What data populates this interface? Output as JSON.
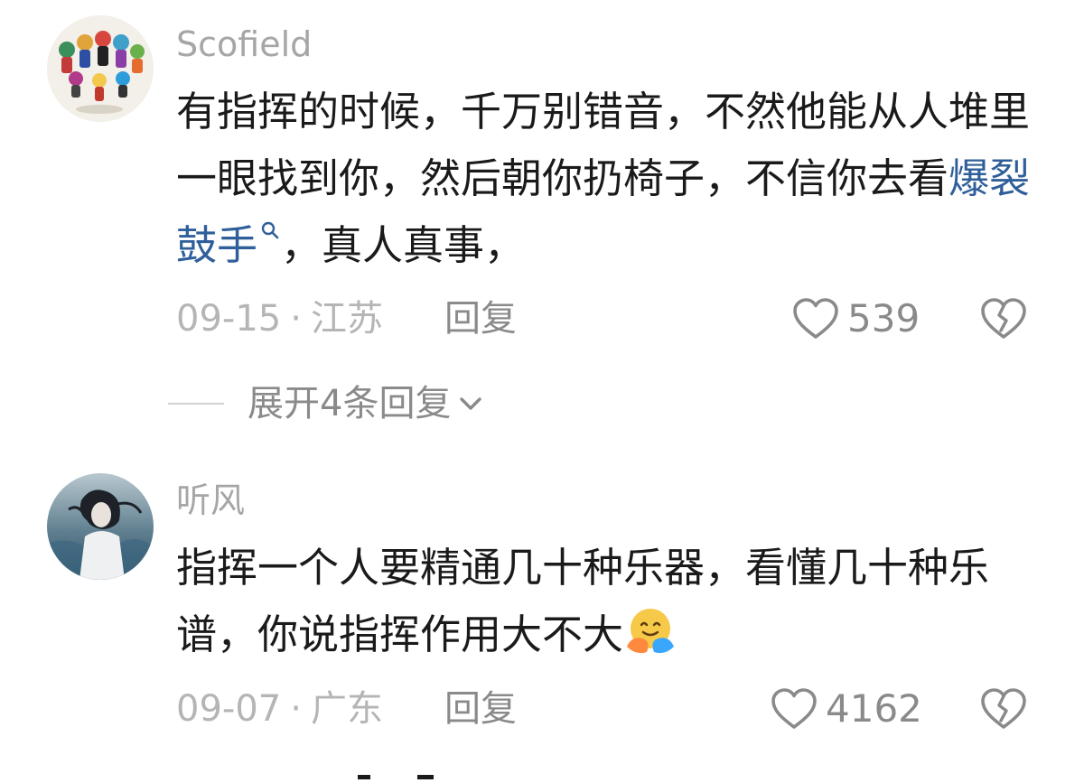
{
  "comments": [
    {
      "username": "Scofield",
      "text_before_link": "有指挥的时候，千万别错音，不然他能从人堆里一眼找到你，然后朝你扔椅子，不信你去看",
      "link_text": "爆裂鼓手",
      "text_after_link": "，真人真事，",
      "date": "09-15",
      "separator": "·",
      "location": "江苏",
      "reply_label": "回复",
      "like_count": "539"
    },
    {
      "username": "听风",
      "text": "指挥一个人要精通几十种乐器，看懂几十种乐谱，你说指挥作用大不大",
      "emoji": "hugging-face-emoji",
      "date": "09-07",
      "separator": "·",
      "location": "广东",
      "reply_label": "回复",
      "like_count": "4162"
    }
  ],
  "expand_replies": {
    "label": "展开4条回复"
  },
  "colors": {
    "link": "#2f5f9a",
    "meta": "#b5b5b5",
    "action": "#8a8a8a",
    "username": "#a6a6a6"
  },
  "icons": [
    "search-icon",
    "heart-icon",
    "broken-heart-icon",
    "chevron-down-icon",
    "hugging-face-emoji"
  ]
}
